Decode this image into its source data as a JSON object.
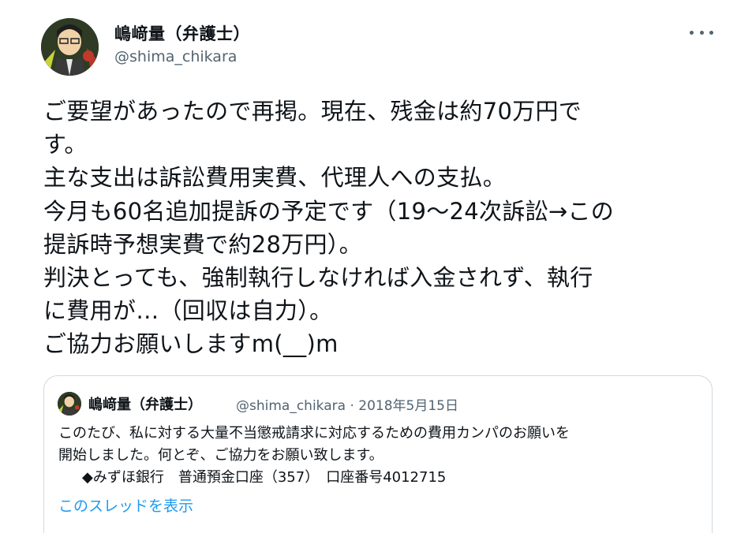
{
  "author": {
    "name": "嶋﨑量（弁護士）",
    "handle": "@shima_chikara"
  },
  "tweet": {
    "lines": [
      "ご要望があったので再掲。現在、残金は約70万円で",
      "す。",
      "主な支出は訴訟費用実費、代理人への支払。",
      "今月も60名追加提訴の予定です（19〜24次訴訟→この",
      "提訴時予想実費で約28万円）。",
      "判決とっても、強制執行しなければ入金されず、執行",
      "に費用が…（回収は自力）。",
      "ご協力お願いしますm(__)m"
    ]
  },
  "quoted": {
    "name": "嶋﨑量（弁護士）",
    "meta": "@shima_chikara · 2018年5月15日",
    "lines": [
      "このたび、私に対する大量不当懲戒請求に対応するための費用カンパのお願いを",
      "開始しました。何とぞ、ご協力をお願い致します。",
      "◆みずほ銀行　普通預金口座（357）　口座番号4012715"
    ],
    "show_thread": "このスレッドを表示"
  },
  "icons": {
    "more": "more-horizontal-icon"
  },
  "colors": {
    "text": "#0f1419",
    "secondary": "#536471",
    "link": "#1d9bf0",
    "border": "#cfd9de"
  }
}
